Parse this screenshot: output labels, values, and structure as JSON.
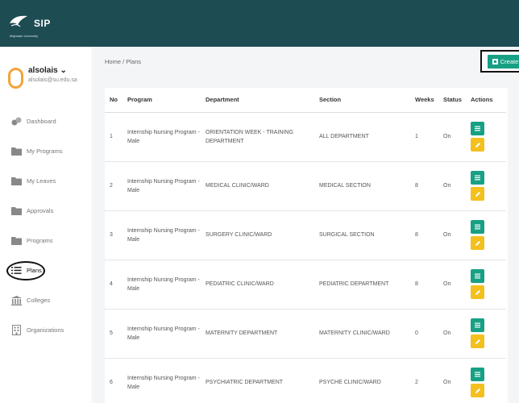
{
  "header": {
    "logo_text": "SIP",
    "logo_sub": "Majmaah University"
  },
  "user": {
    "name": "alsolais",
    "email": "alsolais@su.edu.sa"
  },
  "sidebar": {
    "items": [
      {
        "label": "Dashboard",
        "icon": "dashboard-icon"
      },
      {
        "label": "My Programs",
        "icon": "folder-icon"
      },
      {
        "label": "My Leaves",
        "icon": "folder-icon"
      },
      {
        "label": "Approvals",
        "icon": "folder-icon"
      },
      {
        "label": "Programs",
        "icon": "folder-icon"
      },
      {
        "label": "Plans",
        "icon": "list-icon",
        "active": true
      },
      {
        "label": "Colleges",
        "icon": "building-icon"
      },
      {
        "label": "Organizations",
        "icon": "organization-icon"
      }
    ]
  },
  "breadcrumb": {
    "home": "Home",
    "separator": "/",
    "current": "Plans"
  },
  "create_label": "Create",
  "table": {
    "headers": [
      "No",
      "Program",
      "Department",
      "Section",
      "Weeks",
      "Status",
      "Actions"
    ],
    "rows": [
      {
        "no": "1",
        "program": "Internship Nursing Program - Male",
        "department": "ORIENTATION WEEK - TRAINING DEPARTMENT",
        "section": "ALL DEPARTMENT",
        "weeks": "1",
        "status": "On"
      },
      {
        "no": "2",
        "program": "Internship Nursing Program - Male",
        "department": "MEDICAL CLINIC/WARD",
        "section": "MEDICAL SECTION",
        "weeks": "8",
        "status": "On"
      },
      {
        "no": "3",
        "program": "Internship Nursing Program - Male",
        "department": "SURGERY CLINIC/WARD",
        "section": "SURGICAL SECTION",
        "weeks": "8",
        "status": "On"
      },
      {
        "no": "4",
        "program": "Internship Nursing Program - Male",
        "department": "PEDIATRIC CLINIC/WARD",
        "section": "PEDIATRIC DEPARTMENT",
        "weeks": "8",
        "status": "On"
      },
      {
        "no": "5",
        "program": "Internship Nursing Program - Male",
        "department": "MATERNITY DEPARTMENT",
        "section": "MATERNITY CLINIC/WARD",
        "weeks": "0",
        "status": "On"
      },
      {
        "no": "6",
        "program": "Internship Nursing Program - Male",
        "department": "PSYCHIATRIC DEPARTMENT",
        "section": "PSYCHE CLINIC/WARD",
        "weeks": "2",
        "status": "On"
      }
    ]
  },
  "colors": {
    "topbar": "#1e4c53",
    "view_button": "#17a084",
    "edit_button": "#f4c01d",
    "avatar_ring": "#f2a43a"
  }
}
